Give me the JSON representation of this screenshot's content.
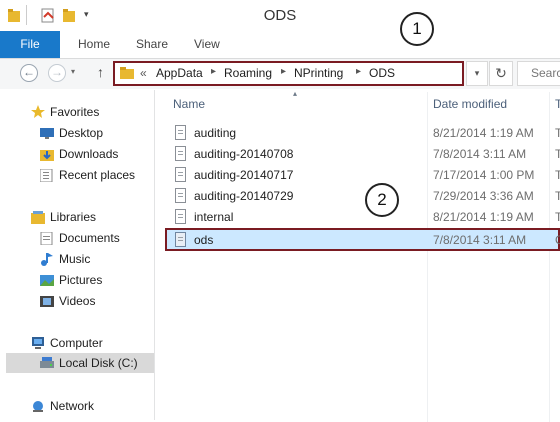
{
  "window": {
    "title": "ODS"
  },
  "ribbon": {
    "file": "File",
    "tabs": [
      "Home",
      "Share",
      "View"
    ]
  },
  "address": {
    "overflow": "«",
    "crumbs": [
      "AppData",
      "Roaming",
      "NPrinting",
      "ODS"
    ],
    "separator": "▸"
  },
  "search": {
    "placeholder": "Searc"
  },
  "nav": {
    "favorites": "Favorites",
    "favorites_items": [
      "Desktop",
      "Downloads",
      "Recent places"
    ],
    "libraries": "Libraries",
    "library_items": [
      "Documents",
      "Music",
      "Pictures",
      "Videos"
    ],
    "computer": "Computer",
    "computer_items": [
      "Local Disk (C:)"
    ],
    "network": "Network"
  },
  "columns": {
    "name": "Name",
    "date": "Date modified",
    "type": "T"
  },
  "files": [
    {
      "name": "auditing",
      "date": "8/21/2014 1:19 AM",
      "type": "T"
    },
    {
      "name": "auditing-20140708",
      "date": "7/8/2014 3:11 AM",
      "type": "T"
    },
    {
      "name": "auditing-20140717",
      "date": "7/17/2014 1:00 PM",
      "type": "T"
    },
    {
      "name": "auditing-20140729",
      "date": "7/29/2014 3:36 AM",
      "type": "T"
    },
    {
      "name": "internal",
      "date": "8/21/2014 1:19 AM",
      "type": "T"
    },
    {
      "name": "ods",
      "date": "7/8/2014 3:11 AM",
      "type": "C"
    }
  ],
  "callouts": [
    "1",
    "2"
  ],
  "colors": {
    "file_tab": "#1979ca",
    "highlight_border": "#7a1b22",
    "selected_row": "#cce8ff"
  }
}
